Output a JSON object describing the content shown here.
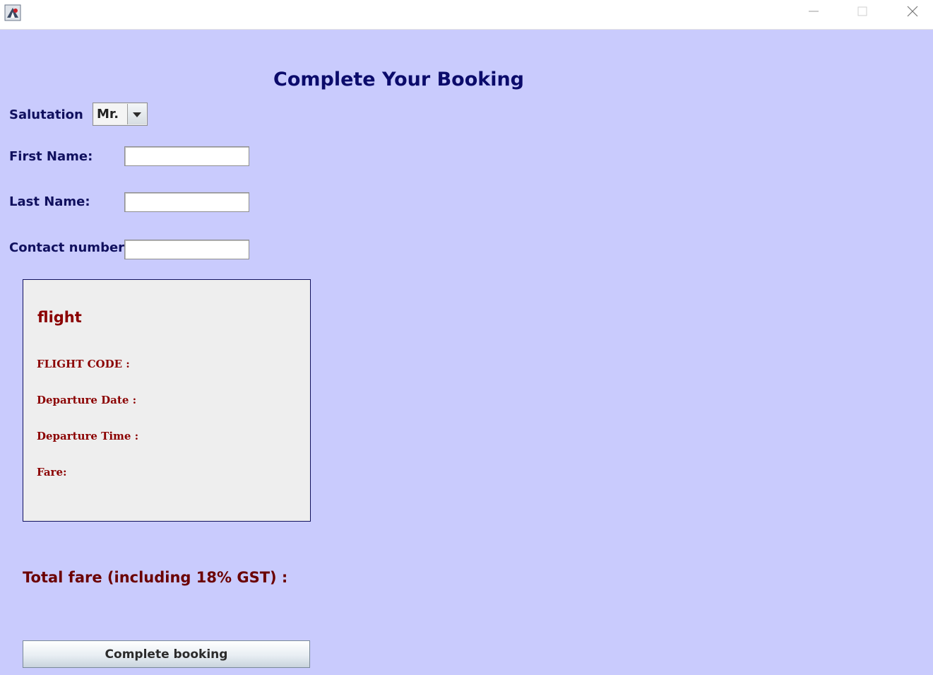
{
  "window": {
    "icon": "java-app-icon",
    "controls": {
      "minimize": "minimize-icon",
      "maximize": "maximize-icon",
      "close": "close-icon"
    }
  },
  "form": {
    "heading": "Complete Your Booking",
    "salutation_label": "Salutation",
    "salutation_value": "Mr.",
    "first_name_label": "First Name:",
    "first_name_value": "",
    "last_name_label": "Last Name:",
    "last_name_value": "",
    "contact_label": "Contact number",
    "contact_value": ""
  },
  "flight_panel": {
    "title": "flight",
    "flight_code_label": "FLIGHT CODE :",
    "departure_date_label": "Departure Date :",
    "departure_time_label": "Departure Time :",
    "fare_label": "Fare:"
  },
  "summary": {
    "total_fare_label": "Total fare (including 18% GST) :"
  },
  "actions": {
    "complete_button": "Complete booking"
  },
  "colors": {
    "background": "#c9cbfd",
    "heading": "#0b0b6b",
    "flight_text": "#8b0000",
    "panel_background": "#eeeeee"
  }
}
